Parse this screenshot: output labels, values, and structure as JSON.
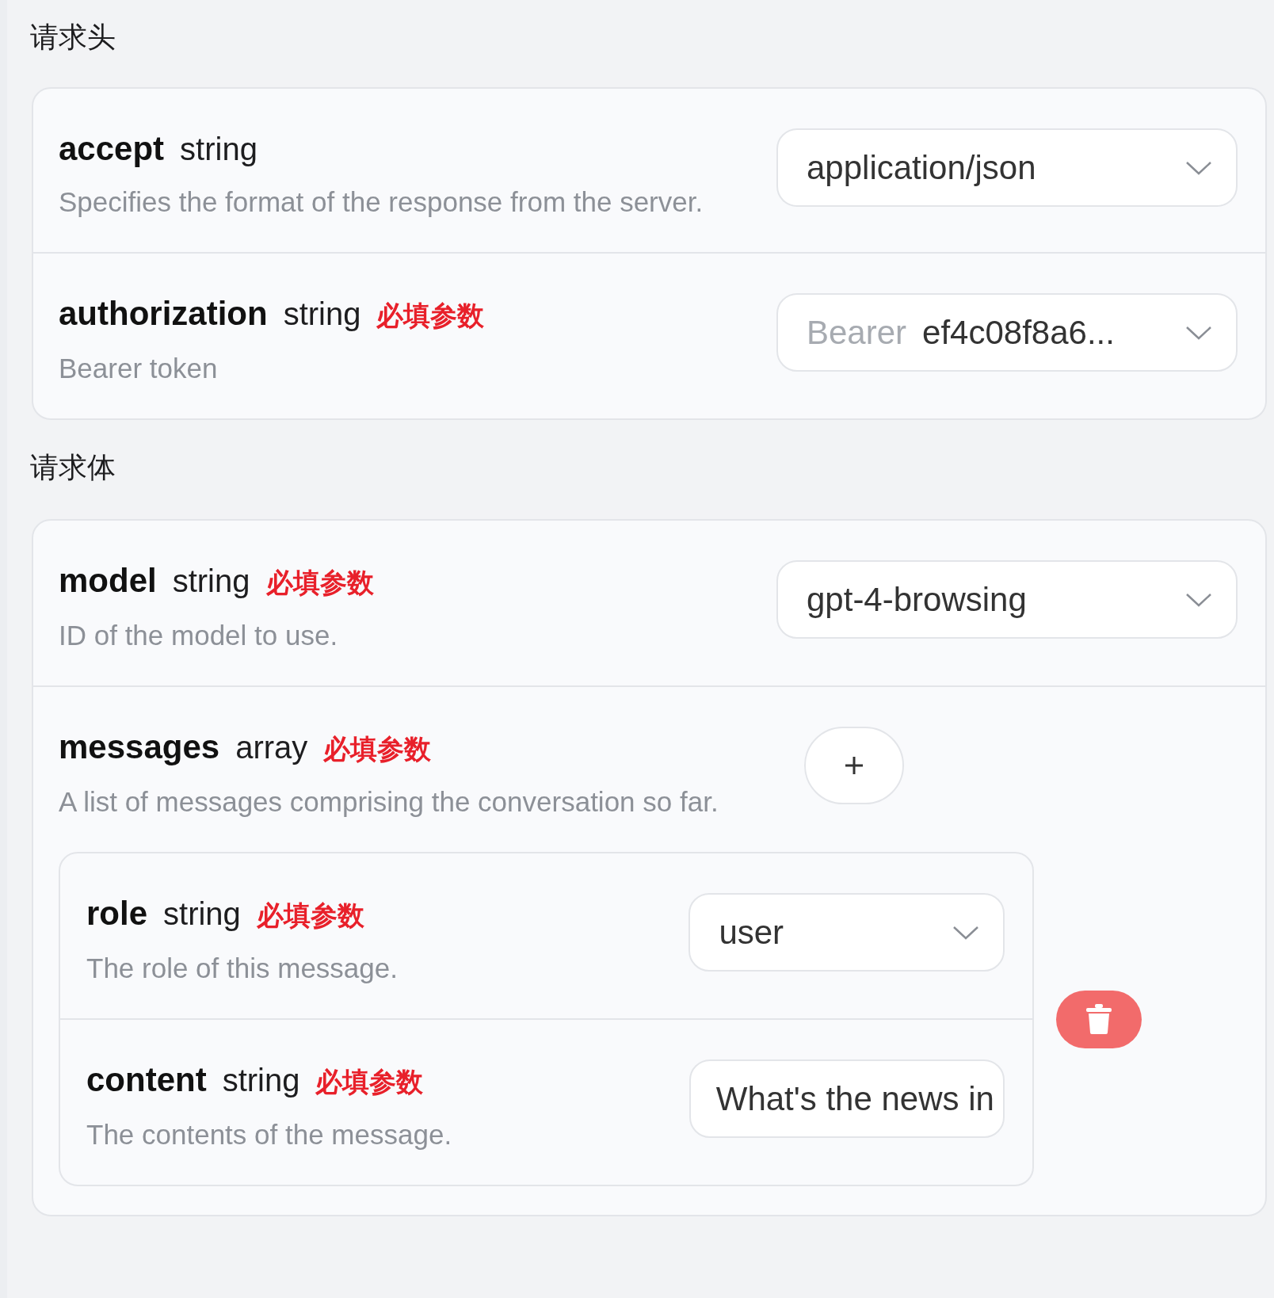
{
  "sections": [
    {
      "title": "请求头",
      "params": [
        {
          "name": "accept",
          "type": "string",
          "description": "Specifies the format of the response from the server.",
          "control": {
            "kind": "select",
            "value": "application/json"
          }
        },
        {
          "name": "authorization",
          "type": "string",
          "badge": "必填参数",
          "description": "Bearer token",
          "control": {
            "kind": "select",
            "prefix": "Bearer",
            "value": "ef4c08f8a6..."
          }
        }
      ]
    },
    {
      "title": "请求体",
      "params": [
        {
          "name": "model",
          "type": "string",
          "badge": "必填参数",
          "description": "ID of the model to use.",
          "control": {
            "kind": "select",
            "value": "gpt-4-browsing"
          }
        },
        {
          "name": "messages",
          "type": "array",
          "badge": "必填参数",
          "description": "A list of messages comprising the conversation so far.",
          "control": {
            "kind": "add"
          },
          "items": [
            {
              "fields": [
                {
                  "name": "role",
                  "type": "string",
                  "badge": "必填参数",
                  "description": "The role of this message.",
                  "control": {
                    "kind": "select",
                    "value": "user"
                  }
                },
                {
                  "name": "content",
                  "type": "string",
                  "badge": "必填参数",
                  "description": "The contents of the message.",
                  "control": {
                    "kind": "input",
                    "value": "What's the news in"
                  }
                }
              ]
            }
          ]
        }
      ]
    }
  ]
}
